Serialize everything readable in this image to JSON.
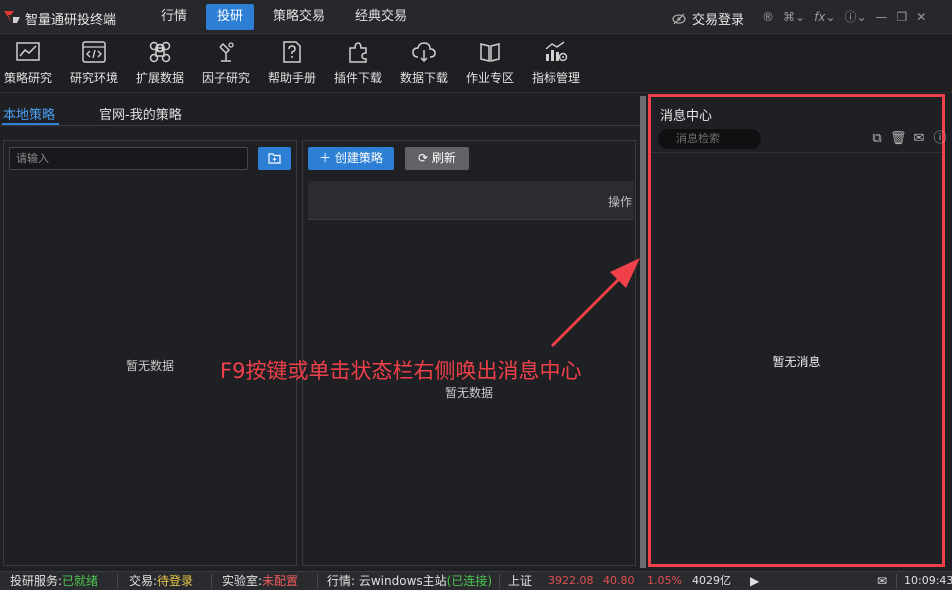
{
  "app": {
    "title": "智量通研投终端"
  },
  "nav": {
    "tabs": [
      "行情",
      "投研",
      "策略交易",
      "经典交易"
    ],
    "active": "投研"
  },
  "titlebar": {
    "trade_login": "交易登录",
    "icons": [
      "eye-off-icon",
      "register-icon",
      "grid-icon",
      "fx-icon",
      "help-icon",
      "minimize-icon",
      "restore-icon",
      "close-icon"
    ],
    "fx_label": "fx"
  },
  "toolbar": {
    "items": [
      {
        "label": "策略研究",
        "icon": "chart-line-icon"
      },
      {
        "label": "研究环境",
        "icon": "code-icon"
      },
      {
        "label": "扩展数据",
        "icon": "command-icon"
      },
      {
        "label": "因子研究",
        "icon": "flask-icon"
      },
      {
        "label": "帮助手册",
        "icon": "help-doc-icon"
      },
      {
        "label": "插件下载",
        "icon": "puzzle-icon"
      },
      {
        "label": "数据下载",
        "icon": "cloud-download-icon"
      },
      {
        "label": "作业专区",
        "icon": "book-icon"
      },
      {
        "label": "指标管理",
        "icon": "indicator-settings-icon"
      }
    ]
  },
  "strategy_panel": {
    "tabs": [
      "本地策略",
      "官网-我的策略"
    ],
    "search_placeholder": "请输入",
    "empty_left": "暂无数据",
    "create_label": "创建策略",
    "refresh_label": "刷新",
    "table_header_op": "操作",
    "empty_right": "暂无数据"
  },
  "annotation": "F9按键或单击状态栏右侧唤出消息中心",
  "message_center": {
    "title": "消息中心",
    "search_placeholder": "消息检索",
    "empty": "暂无消息",
    "icons": [
      "copy-icon",
      "trash-icon",
      "mail-icon",
      "help-icon"
    ]
  },
  "status_bar": {
    "research_label": "投研服务:",
    "research_value": "已就绪",
    "trade_label": "交易:",
    "trade_value": "待登录",
    "lab_label": "实验室:",
    "lab_value": "未配置",
    "quote_label": "行情: 云windows主站",
    "quote_value": "(已连接)",
    "index_name": "上证",
    "index_price": "3922.08",
    "index_change": "40.80",
    "index_pct": "1.05%",
    "index_volume": "4029亿",
    "time": "10:09:43"
  },
  "colors": {
    "accent": "#2d7fd6",
    "highlight": "#f0414a",
    "ok": "#4bc44b",
    "pending": "#e8c547",
    "warn": "#f05a5a"
  }
}
